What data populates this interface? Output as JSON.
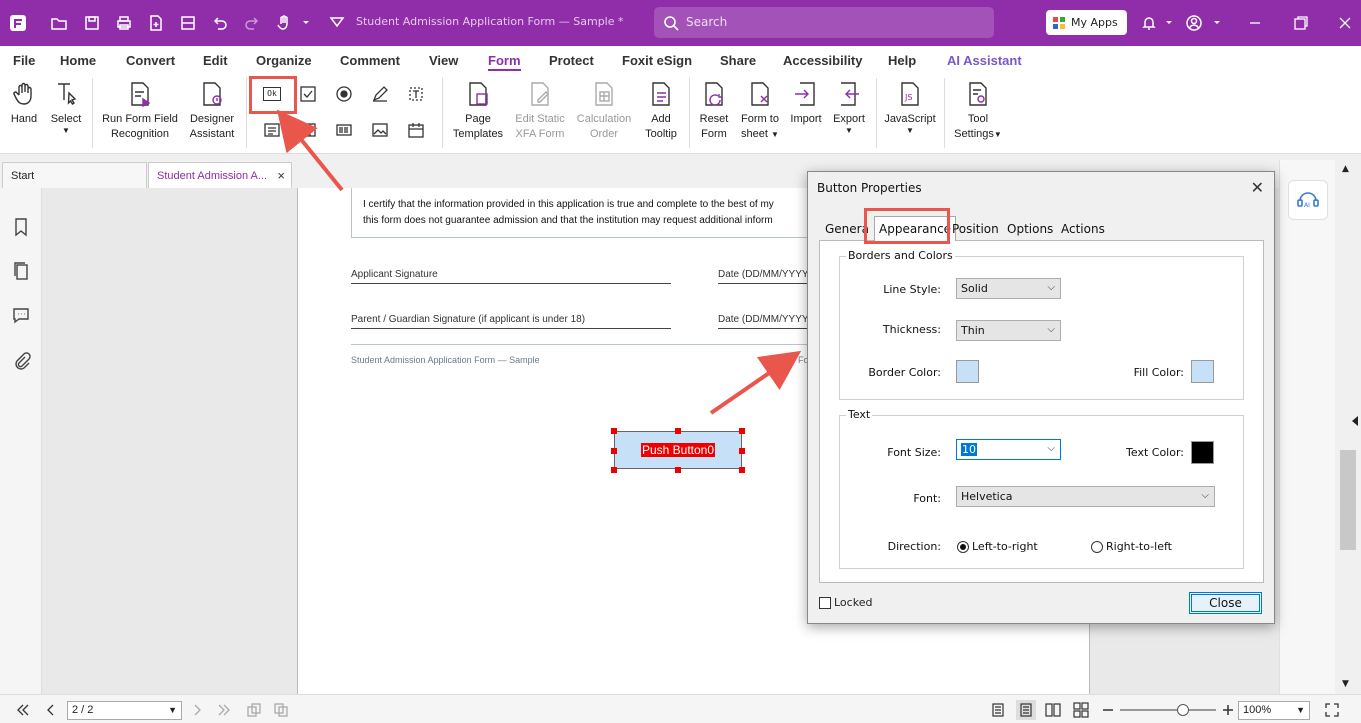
{
  "titlebar": {
    "doc_title": "Student Admission Application Form — Sample *",
    "search_placeholder": "Search",
    "my_apps": "My Apps"
  },
  "menu": {
    "items": [
      "File",
      "Home",
      "Convert",
      "Edit",
      "Organize",
      "Comment",
      "View",
      "Form",
      "Protect",
      "Foxit eSign",
      "Share",
      "Accessibility",
      "Help",
      "AI Assistant"
    ],
    "active": "Form"
  },
  "ribbon": {
    "hand": "Hand",
    "select": "Select",
    "run_form_1": "Run Form Field",
    "run_form_2": "Recognition",
    "designer_1": "Designer",
    "designer_2": "Assistant",
    "page_tpl_1": "Page",
    "page_tpl_2": "Templates",
    "edit_static_1": "Edit Static",
    "edit_static_2": "XFA Form",
    "calc_1": "Calculation",
    "calc_2": "Order",
    "add_tip_1": "Add",
    "add_tip_2": "Tooltip",
    "reset_1": "Reset",
    "reset_2": "Form",
    "form_sheet_1": "Form to",
    "form_sheet_2": "sheet",
    "import": "Import",
    "export": "Export",
    "javascript": "JavaScript",
    "tool_settings_1": "Tool",
    "tool_settings_2": "Settings",
    "push_button_glyph": "Ok"
  },
  "tabs": {
    "start": "Start",
    "doc": "Student Admission A..."
  },
  "document": {
    "certify_line1": "I certify that the information provided in this application is true and complete to the best of my",
    "certify_line2": "this form does not guarantee admission and that the institution may request additional inform",
    "applicant_sig": "Applicant Signature",
    "date1": "Date (DD/MM/YYYY",
    "guardian_sig": "Parent / Guardian Signature (if applicant is under 18)",
    "date2": "Date (DD/MM/YYYY",
    "footer_left": "Student Admission Application Form — Sample",
    "footer_right": "Fo",
    "push_button": "Push Button0"
  },
  "dialog": {
    "title": "Button Properties",
    "tabs": [
      "Genera",
      "Appearance",
      "Position",
      "Options",
      "Actions"
    ],
    "active_tab": "Appearance",
    "borders_group": "Borders and Colors",
    "line_style_label": "Line Style:",
    "line_style_value": "Solid",
    "thickness_label": "Thickness:",
    "thickness_value": "Thin",
    "border_color_label": "Border Color:",
    "fill_color_label": "Fill Color:",
    "text_group": "Text",
    "font_size_label": "Font Size:",
    "font_size_value": "10",
    "text_color_label": "Text Color:",
    "font_label": "Font:",
    "font_value": "Helvetica",
    "direction_label": "Direction:",
    "ltr": "Left-to-right",
    "rtl": "Right-to-left",
    "locked": "Locked",
    "close": "Close"
  },
  "status": {
    "page": "2 / 2",
    "zoom": "100%",
    "zoom_fraction": 0.66
  },
  "colors": {
    "brand": "#8f2ea8",
    "border_color": "#c5e0f7",
    "fill_color": "#c5e0f7",
    "text_color": "#000000",
    "highlight": "#e9564c"
  }
}
